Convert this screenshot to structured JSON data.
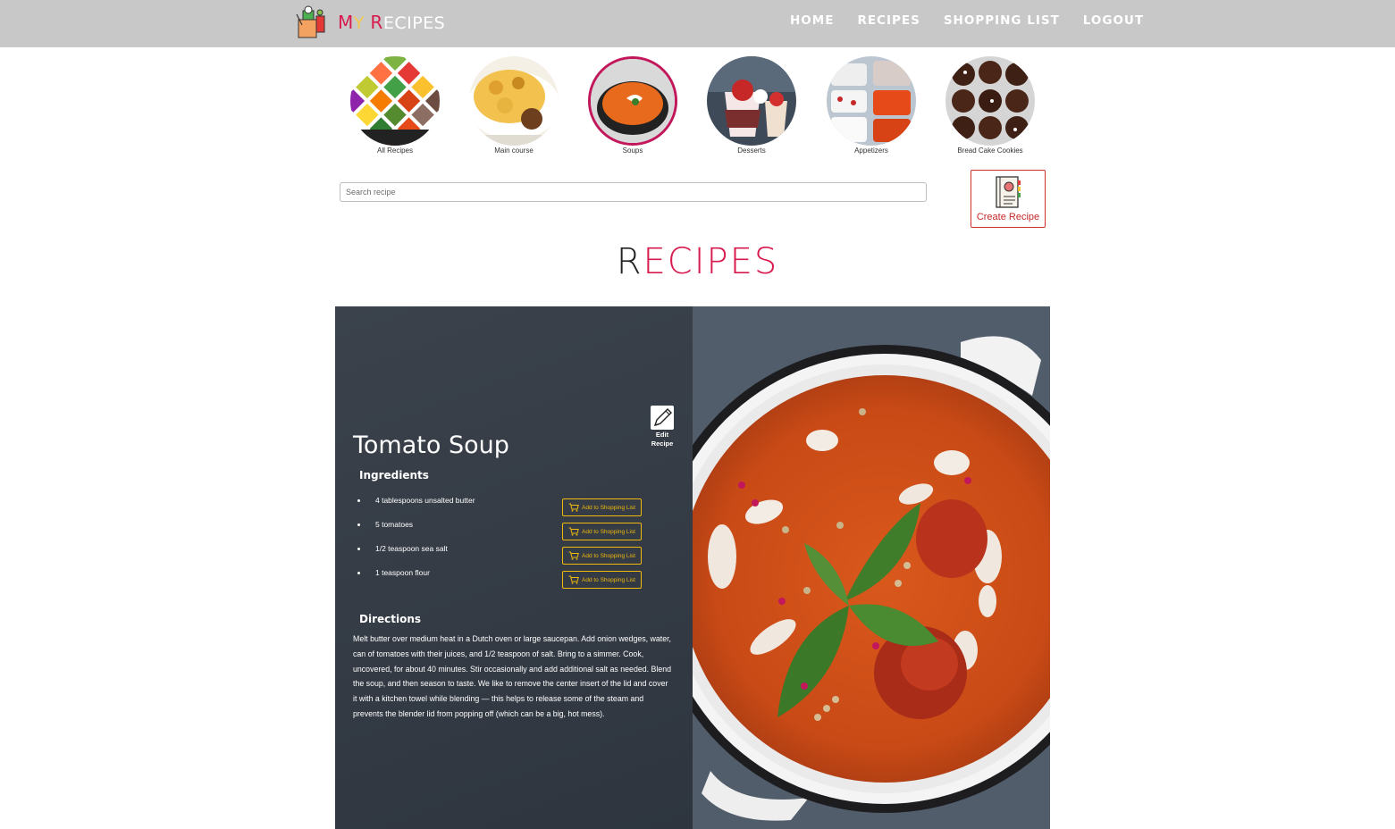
{
  "app": {
    "logo_first": "M",
    "logo_y": "Y",
    "logo_r": "R",
    "logo_rest": "ECIPES"
  },
  "nav": {
    "items": [
      {
        "label": "HOME"
      },
      {
        "label": "RECIPES"
      },
      {
        "label": "SHOPPING LIST"
      },
      {
        "label": "LOGOUT"
      }
    ]
  },
  "categories": [
    {
      "label": "All Recipes"
    },
    {
      "label": "Main course"
    },
    {
      "label": "Soups",
      "active": true
    },
    {
      "label": "Desserts"
    },
    {
      "label": "Appetizers"
    },
    {
      "label": "Bread Cake Cookies"
    }
  ],
  "search": {
    "placeholder": "Search recipe"
  },
  "create": {
    "label": "Create Recipe"
  },
  "page_title": {
    "first": "R",
    "rest": "ECIPES"
  },
  "recipe": {
    "title": "Tomato Soup",
    "edit_line1": "Edit",
    "edit_line2": "Recipe",
    "ingredients_heading": "Ingredients",
    "add_label": "Add to Shopping List",
    "ingredients": [
      "4 tablespoons unsalted butter",
      "5 tomatoes",
      "1/2 teaspoon sea salt",
      "1 teaspoon flour"
    ],
    "directions_heading": "Directions",
    "directions": "Melt butter over medium heat in a Dutch oven or large saucepan. Add onion wedges, water, can of tomatoes with their juices, and 1/2 teaspoon of salt. Bring to a simmer. Cook, uncovered, for about 40 minutes. Stir occasionally and add additional salt as needed. Blend the soup, and then season to taste. We like to remove the center insert of the lid and cover it with a kitchen towel while blending — this helps to release some of the steam and prevents the blender lid from popping off (which can be a big, hot mess)."
  },
  "colors": {
    "accent_red": "#d81b4f",
    "topbar": "#c8c8c8",
    "card_dark": "#3b424c",
    "button_yellow": "#f0b90b"
  }
}
